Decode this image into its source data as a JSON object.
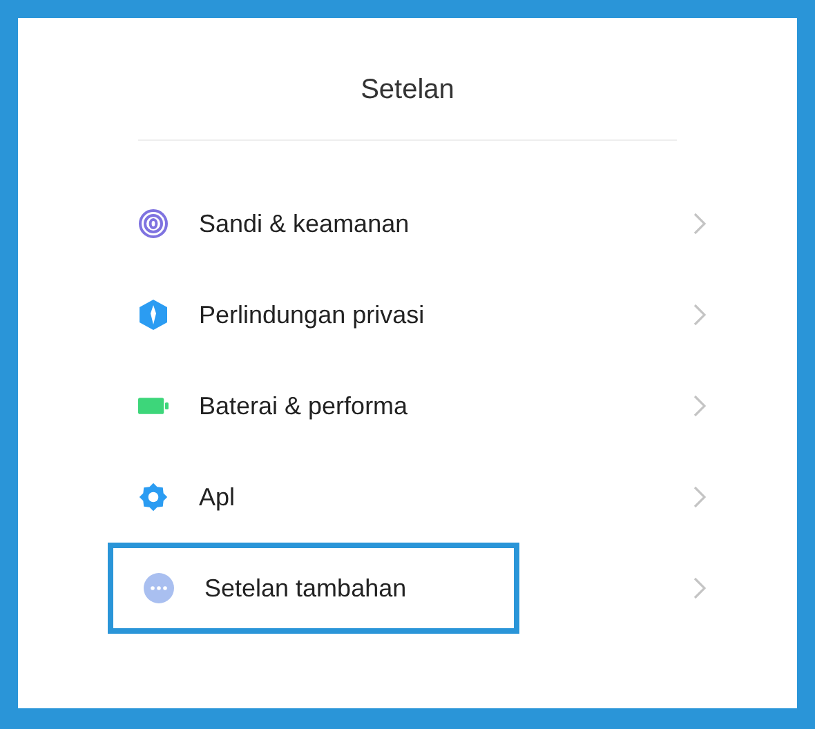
{
  "header": {
    "title": "Setelan"
  },
  "items": [
    {
      "label": "Sandi & keamanan",
      "kind": "fingerprint",
      "highlighted": false
    },
    {
      "label": "Perlindungan privasi",
      "kind": "shield",
      "highlighted": false
    },
    {
      "label": "Baterai & performa",
      "kind": "battery",
      "highlighted": false
    },
    {
      "label": "Apl",
      "kind": "gear",
      "highlighted": false
    },
    {
      "label": "Setelan tambahan",
      "kind": "more",
      "highlighted": true
    }
  ]
}
